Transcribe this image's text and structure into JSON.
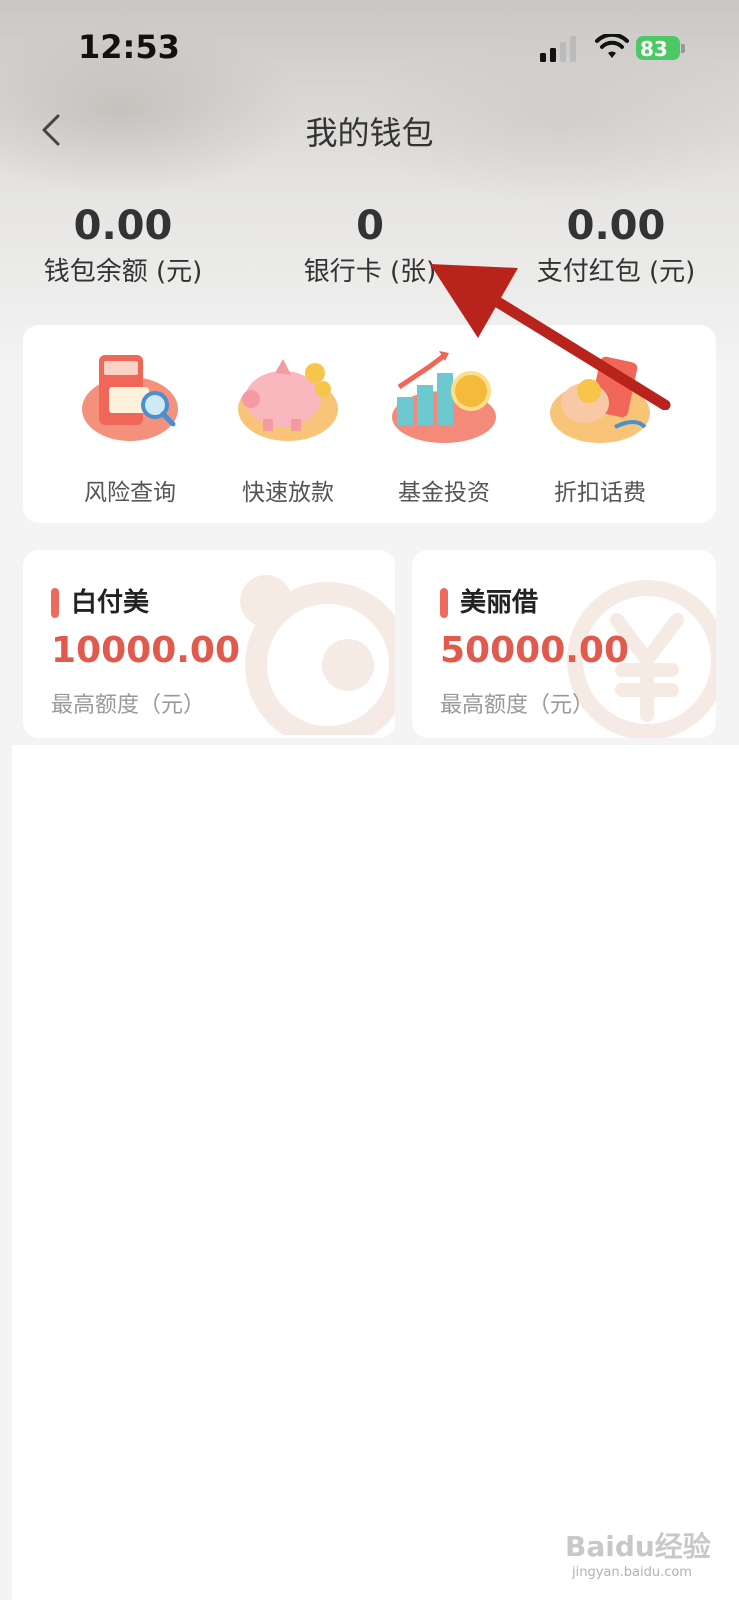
{
  "status_bar": {
    "time": "12:53",
    "battery": "83"
  },
  "nav": {
    "title": "我的钱包"
  },
  "stats": [
    {
      "value": "0.00",
      "label": "钱包余额 (元)"
    },
    {
      "value": "0",
      "label": "银行卡 (张)"
    },
    {
      "value": "0.00",
      "label": "支付红包 (元)"
    }
  ],
  "services": [
    {
      "label": "风险查询",
      "icon": "risk-report-icon"
    },
    {
      "label": "快速放款",
      "icon": "piggy-bank-icon"
    },
    {
      "label": "基金投资",
      "icon": "fund-chart-icon"
    },
    {
      "label": "折扣话费",
      "icon": "phone-discount-icon"
    }
  ],
  "cards": [
    {
      "name": "白付美",
      "amount": "10000.00",
      "subtitle": "最高额度（元）"
    },
    {
      "name": "美丽借",
      "amount": "50000.00",
      "subtitle": "最高额度（元）"
    }
  ],
  "watermark": {
    "text": "Baidu经验",
    "url": "jingyan.baidu.com"
  },
  "colors": {
    "accent": "#e15a4e",
    "arrow": "#b8241c"
  }
}
